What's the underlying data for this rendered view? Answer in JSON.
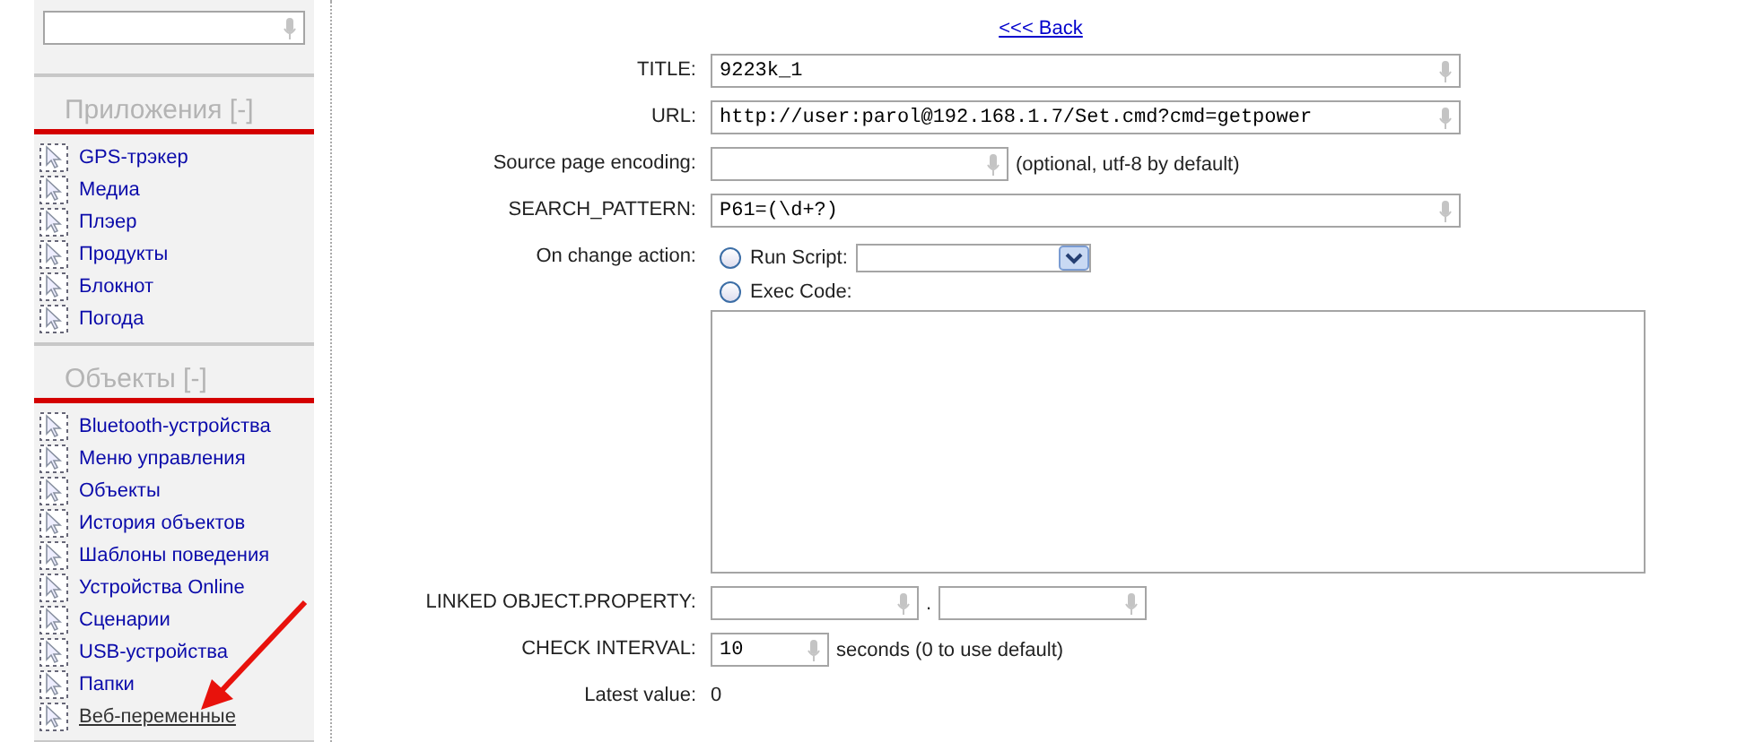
{
  "back_link": "<<< Back",
  "sidebar": {
    "sections": [
      {
        "title": "Приложения [-]",
        "items": [
          {
            "label": "GPS-трэкер",
            "selected": false
          },
          {
            "label": "Медиа",
            "selected": false
          },
          {
            "label": "Плэер",
            "selected": false
          },
          {
            "label": "Продукты",
            "selected": false
          },
          {
            "label": "Блокнот",
            "selected": false
          },
          {
            "label": "Погода",
            "selected": false
          }
        ]
      },
      {
        "title": "Объекты [-]",
        "items": [
          {
            "label": "Bluetooth-устройства",
            "selected": false
          },
          {
            "label": "Меню управления",
            "selected": false
          },
          {
            "label": "Объекты",
            "selected": false
          },
          {
            "label": "История объектов",
            "selected": false
          },
          {
            "label": "Шаблоны поведения",
            "selected": false
          },
          {
            "label": "Устройства Online",
            "selected": false
          },
          {
            "label": "Сценарии",
            "selected": false
          },
          {
            "label": "USB-устройства",
            "selected": false
          },
          {
            "label": "Папки",
            "selected": false
          },
          {
            "label": "Веб-переменные",
            "selected": true
          }
        ]
      }
    ]
  },
  "form": {
    "rows": [
      {
        "kind": "text",
        "label": "TITLE:",
        "value": "9223k_1"
      },
      {
        "kind": "text",
        "label": "URL:",
        "value": "http://user:parol@192.168.1.7/Set.cmd?cmd=getpower"
      },
      {
        "kind": "short",
        "label": "Source page encoding:",
        "note": "(optional, utf-8 by default)"
      },
      {
        "kind": "text",
        "label": "SEARCH_PATTERN:",
        "value": "P61=(\\d+?)"
      },
      {
        "kind": "action",
        "label": "On change action:",
        "options": [
          {
            "kind": "select",
            "label": "Run Script:",
            "checked": false
          },
          {
            "kind": "code",
            "label": "Exec Code:",
            "checked": false
          }
        ]
      },
      {
        "kind": "linked",
        "label": "LINKED OBJECT.PROPERTY:",
        "separator": "."
      },
      {
        "kind": "interval",
        "label": "CHECK INTERVAL:",
        "value": "10",
        "note": "seconds (0 to use default)"
      },
      {
        "kind": "readout",
        "label": "Latest value:",
        "value": "0"
      }
    ]
  }
}
